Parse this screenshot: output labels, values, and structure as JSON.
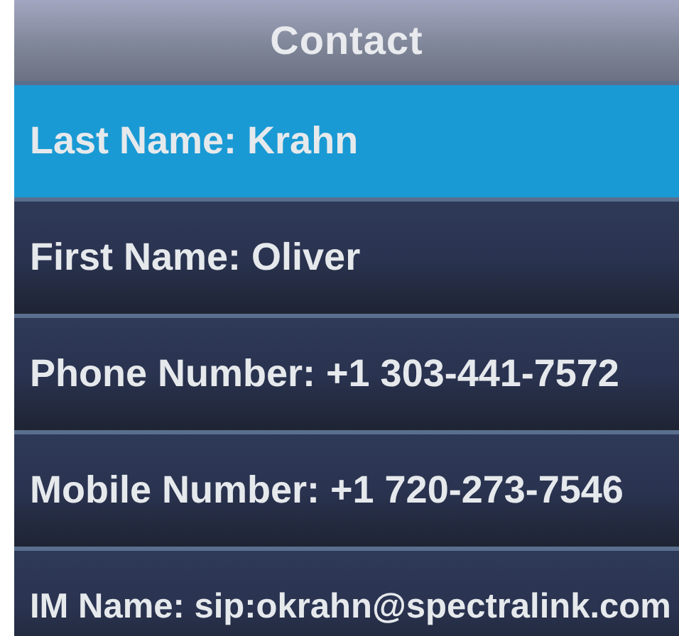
{
  "header": {
    "title": "Contact"
  },
  "fields": [
    {
      "text": "Last Name: Krahn",
      "selected": true
    },
    {
      "text": "First Name: Oliver",
      "selected": false
    },
    {
      "text": "Phone Number: +1 303-441-7572",
      "selected": false
    },
    {
      "text": "Mobile Number: +1 720-273-7546",
      "selected": false
    },
    {
      "text": "IM Name: sip:okrahn@spectralink.com",
      "selected": false
    }
  ]
}
